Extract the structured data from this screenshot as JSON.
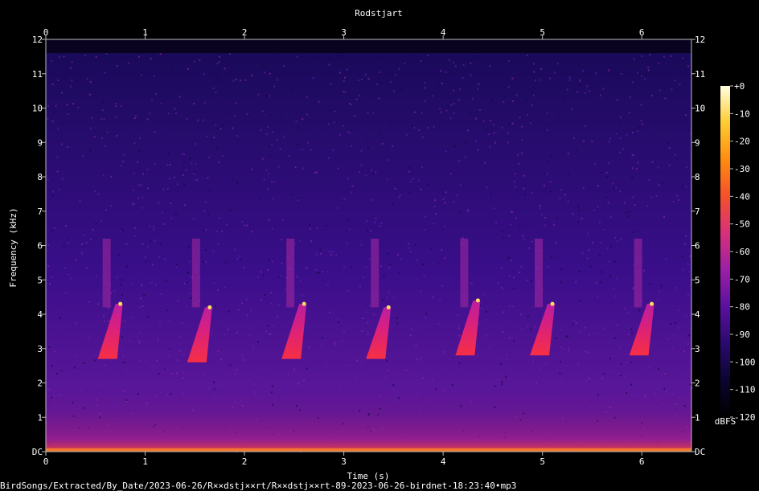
{
  "chart_data": {
    "type": "heatmap",
    "title": "Rodstjart",
    "xlabel": "Time (s)",
    "ylabel": "Frequency (kHz)",
    "xlim": [
      0,
      6.5
    ],
    "ylim": [
      0,
      12
    ],
    "x_ticks": [
      "0",
      "1",
      "2",
      "3",
      "4",
      "5",
      "6"
    ],
    "y_ticks": [
      "DC",
      "1",
      "2",
      "3",
      "4",
      "5",
      "6",
      "7",
      "8",
      "9",
      "10",
      "11",
      "12"
    ],
    "colorbar": {
      "label": "dBFS",
      "range": [
        -120,
        0
      ],
      "ticks": [
        "+0",
        "-10",
        "-20",
        "-30",
        "-40",
        "-50",
        "-60",
        "-70",
        "-80",
        "-90",
        "-100",
        "-110",
        "-120"
      ]
    },
    "colormap": [
      "#000000",
      "#0b0530",
      "#2a0a6e",
      "#5a10a0",
      "#9b1fa6",
      "#d8307a",
      "#f5502a",
      "#ff8c10",
      "#ffcc30",
      "#ffffe0"
    ],
    "song_phrases": [
      {
        "time": 0.75,
        "freq_low": 2.7,
        "freq_high": 4.3
      },
      {
        "time": 1.65,
        "freq_low": 2.6,
        "freq_high": 4.2
      },
      {
        "time": 2.6,
        "freq_low": 2.7,
        "freq_high": 4.3
      },
      {
        "time": 3.45,
        "freq_low": 2.7,
        "freq_high": 4.2
      },
      {
        "time": 4.35,
        "freq_low": 2.8,
        "freq_high": 4.4
      },
      {
        "time": 5.1,
        "freq_low": 2.8,
        "freq_high": 4.3
      },
      {
        "time": 6.1,
        "freq_low": 2.8,
        "freq_high": 4.3
      }
    ],
    "grid": false
  },
  "footer": {
    "file_path": "BirdSongs/Extracted/By_Date/2023-06-26/R××dstj××rt/R××dstj××rt-89-2023-06-26-birdnet-18:23:40•mp3"
  }
}
